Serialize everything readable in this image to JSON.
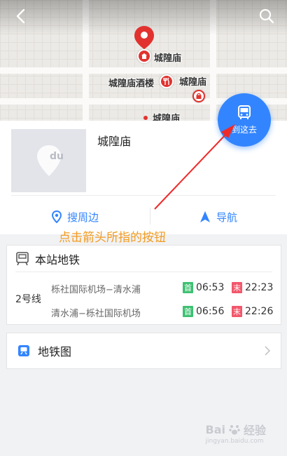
{
  "map": {
    "pois": {
      "main": "城隍庙",
      "restaurant": "城隍庙酒楼",
      "secondary": "城隍庙",
      "partial": "城隍庙"
    }
  },
  "go_button": {
    "label": "到这去"
  },
  "place": {
    "title": "城隍庙",
    "thumb_logo": "du"
  },
  "actions": {
    "nearby": "搜周边",
    "navigate": "导航"
  },
  "annotation": {
    "text": "点击箭头所指的按钮"
  },
  "subway": {
    "header": "本站地铁",
    "line": "2号线",
    "first_label": "首",
    "last_label": "末",
    "routes": [
      {
        "direction": "栎社国际机场−清水浦",
        "first": "06:53",
        "last": "22:23"
      },
      {
        "direction": "清水浦−栎社国际机场",
        "first": "06:56",
        "last": "22:26"
      }
    ]
  },
  "subway_map": {
    "label": "地铁图"
  },
  "watermark": {
    "brand": "Bai",
    "suffix": "经验",
    "sub": "jingyan.baidu.com"
  },
  "colors": {
    "accent": "#3385ff",
    "poi_red": "#e1322f",
    "annotation": "#f29b1f",
    "arrow": "#ee2b2b",
    "first_badge": "#3ec172",
    "last_badge": "#f2576b"
  }
}
